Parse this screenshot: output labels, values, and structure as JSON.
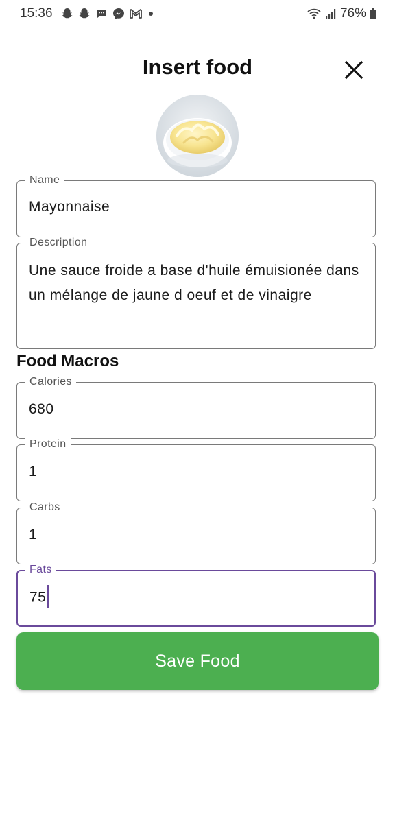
{
  "status_bar": {
    "time": "15:36",
    "battery": "76%",
    "left_icons": [
      "snapchat-icon",
      "snapchat-icon",
      "chat-bubble-icon",
      "messenger-icon",
      "gmail-icon",
      "more-notifications-dot"
    ],
    "right_icons": [
      "wifi-icon",
      "signal-icon",
      "battery-icon"
    ]
  },
  "header": {
    "title": "Insert food",
    "close_icon": "close-icon"
  },
  "food": {
    "image": "mayonnaise-bowl"
  },
  "form": {
    "name_label": "Name",
    "name_value": "Mayonnaise",
    "description_label": "Description",
    "description_value": "Une sauce froide a base d'huile émuisionée dans un mélange de jaune d oeuf et de vinaigre",
    "section_title": "Food Macros",
    "calories_label": "Calories",
    "calories_value": "680",
    "protein_label": "Protein",
    "protein_value": "1",
    "carbs_label": "Carbs",
    "carbs_value": "1",
    "fats_label": "Fats",
    "fats_value": "75"
  },
  "actions": {
    "save_label": "Save Food"
  },
  "colors": {
    "primary_button": "#4caf50",
    "focus_accent": "#6a4a9b",
    "field_border": "#7a7a7a"
  }
}
